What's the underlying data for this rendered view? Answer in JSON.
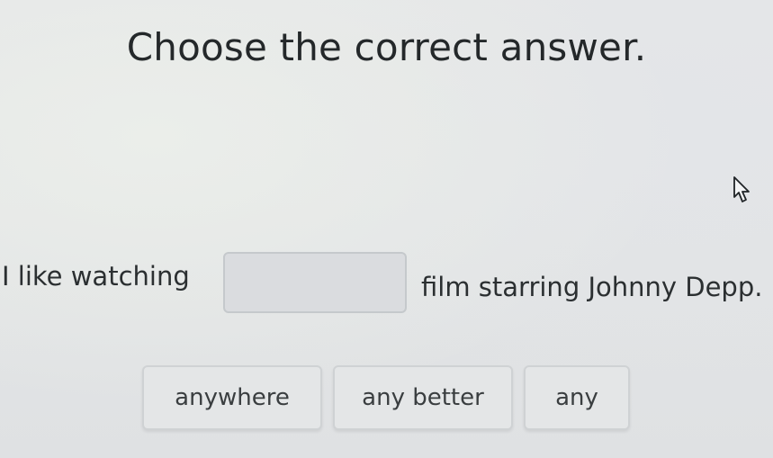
{
  "prompt": {
    "title": "Choose the correct answer."
  },
  "question": {
    "before_blank": "I like watching",
    "after_blank": "film starring Johnny Depp.",
    "blank_value": ""
  },
  "options": [
    {
      "label": "anywhere"
    },
    {
      "label": "any better"
    },
    {
      "label": "any"
    }
  ],
  "cursor": {
    "icon": "arrow-pointer-icon"
  }
}
